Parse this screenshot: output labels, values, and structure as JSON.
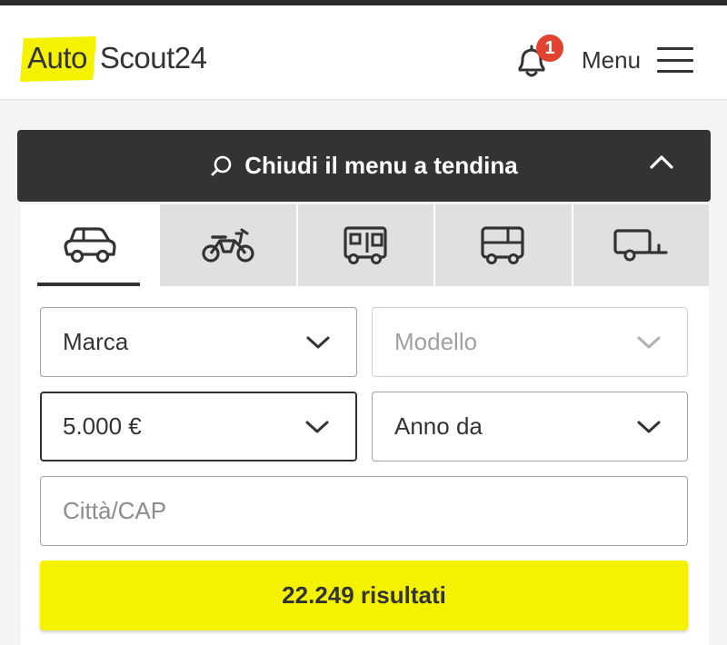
{
  "header": {
    "logo_auto": "Auto",
    "logo_scout": "Scout24",
    "notification_count": "1",
    "menu_label": "Menu"
  },
  "search": {
    "collapse_label": "Chiudi il menu a tendina",
    "tabs": [
      {
        "icon": "car-icon",
        "active": true
      },
      {
        "icon": "motorbike-icon",
        "active": false
      },
      {
        "icon": "camper-icon",
        "active": false
      },
      {
        "icon": "truck-icon",
        "active": false
      },
      {
        "icon": "trailer-icon",
        "active": false
      }
    ],
    "make": "Marca",
    "model": "Modello",
    "price": "5.000 €",
    "year": "Anno da",
    "location_placeholder": "Città/CAP",
    "results_label": "22.249 risultati"
  },
  "colors": {
    "accent": "#f5f200",
    "dark": "#333333",
    "badge": "#e0432f"
  }
}
